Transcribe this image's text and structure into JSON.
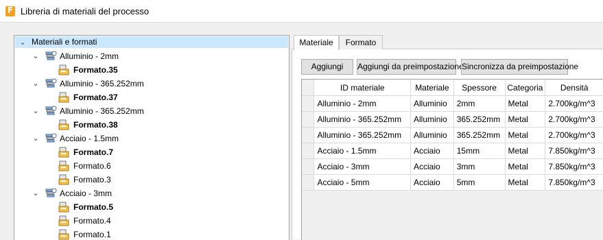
{
  "window": {
    "title": "Libreria di materiali del processo"
  },
  "tree": {
    "root_label": "Materiali e formati",
    "materials": [
      {
        "label": "Alluminio - 2mm",
        "formats": [
          {
            "label": "Formato.35",
            "bold": true
          }
        ]
      },
      {
        "label": "Alluminio - 365.252mm",
        "formats": [
          {
            "label": "Formato.37",
            "bold": true
          }
        ]
      },
      {
        "label": "Alluminio - 365.252mm",
        "formats": [
          {
            "label": "Formato.38",
            "bold": true
          }
        ]
      },
      {
        "label": "Acciaio - 1.5mm",
        "formats": [
          {
            "label": "Formato.7",
            "bold": true
          },
          {
            "label": "Formato.6",
            "bold": false
          },
          {
            "label": "Formato.3",
            "bold": false
          }
        ]
      },
      {
        "label": "Acciaio - 3mm",
        "formats": [
          {
            "label": "Formato.5",
            "bold": true
          },
          {
            "label": "Formato.4",
            "bold": false
          },
          {
            "label": "Formato.1",
            "bold": false
          }
        ]
      }
    ]
  },
  "tabs": [
    {
      "label": "Materiale"
    },
    {
      "label": "Formato"
    }
  ],
  "buttons": {
    "add": "Aggiungi",
    "add_preset": "Aggiungi da preimpostazione",
    "sync_preset": "Sincronizza da preimpostazione"
  },
  "table": {
    "columns": [
      "ID materiale",
      "Materiale",
      "Spessore",
      "Categoria",
      "Densità"
    ],
    "rows": [
      [
        "Alluminio - 2mm",
        "Alluminio",
        "2mm",
        "Metal",
        "2.700kg/m^3"
      ],
      [
        "Alluminio - 365.252mm",
        "Alluminio",
        "365.252mm",
        "Metal",
        "2.700kg/m^3"
      ],
      [
        "Alluminio - 365.252mm",
        "Alluminio",
        "365.252mm",
        "Metal",
        "2.700kg/m^3"
      ],
      [
        "Acciaio - 1.5mm",
        "Acciaio",
        "15mm",
        "Metal",
        "7.850kg/m^3"
      ],
      [
        "Acciaio - 3mm",
        "Acciaio",
        "3mm",
        "Metal",
        "7.850kg/m^3"
      ],
      [
        "Acciaio - 5mm",
        "Acciaio",
        "5mm",
        "Metal",
        "7.850kg/m^3"
      ]
    ]
  },
  "colors": {
    "selection": "#cce8ff",
    "app_icon": "#f6a021",
    "format_icon": "#f2c14e"
  },
  "icons": {
    "app": "fusion-app-icon",
    "expand": "chevron-down-icon",
    "material": "material-icon",
    "format": "format-sheet-icon"
  }
}
